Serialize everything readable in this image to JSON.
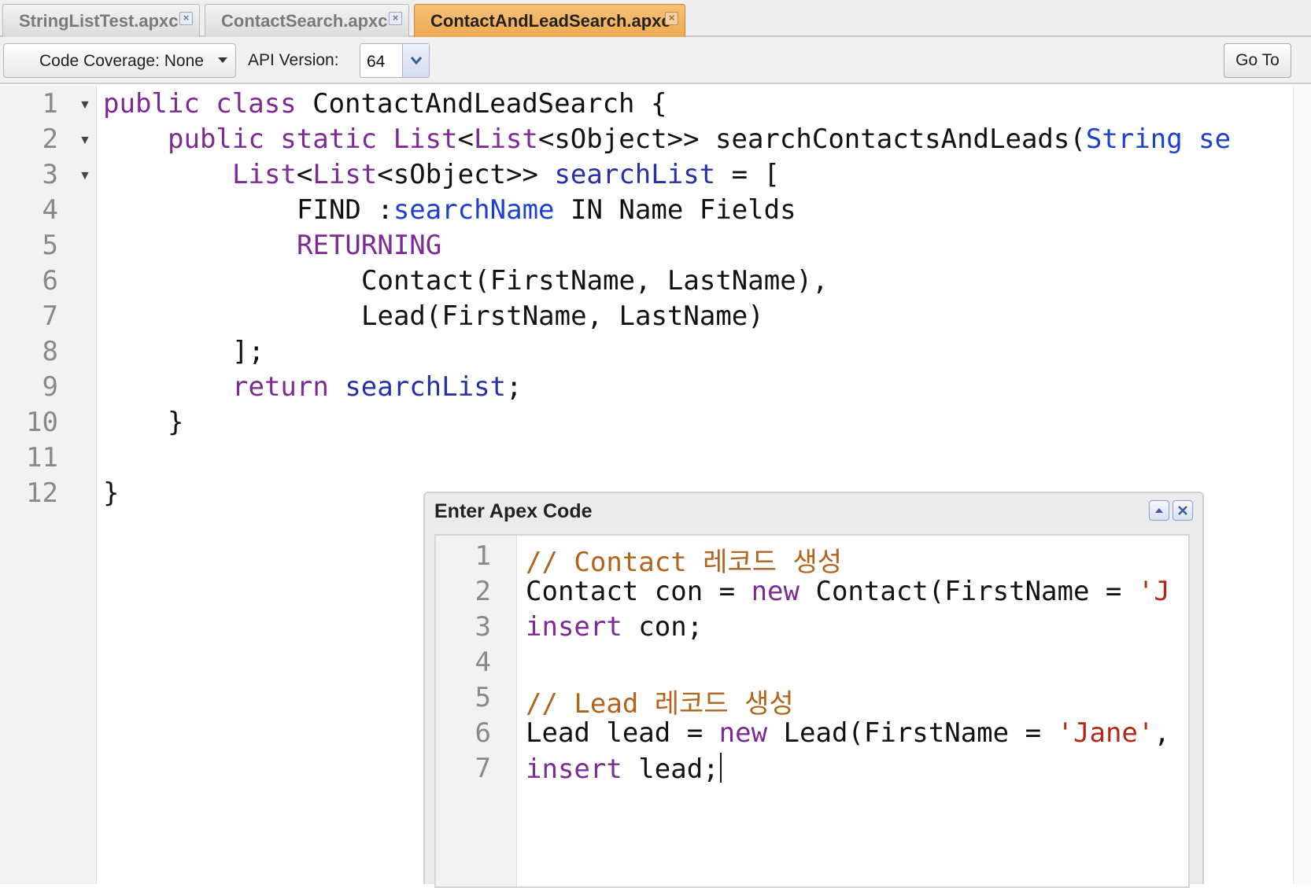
{
  "tabs": [
    {
      "label": "StringListTest.apxc",
      "active": false
    },
    {
      "label": "ContactSearch.apxc",
      "active": false
    },
    {
      "label": "ContactAndLeadSearch.apxc",
      "active": true
    }
  ],
  "toolbar": {
    "coverage_label": "Code Coverage: None",
    "api_label": "API Version:",
    "api_value": "64",
    "goto_label": "Go To"
  },
  "editor": {
    "line_numbers": [
      "1",
      "2",
      "3",
      "4",
      "5",
      "6",
      "7",
      "8",
      "9",
      "10",
      "11",
      "12"
    ],
    "lines": {
      "l1": {
        "a": "public class",
        "b": " ContactAndLeadSearch {"
      },
      "l2": {
        "a": "public static",
        "b": " ",
        "c": "List",
        "d": "<",
        "e": "List",
        "f": "<sObject>> searchContactsAndLeads(",
        "g": "String se"
      },
      "l3": {
        "a": "List",
        "b": "<",
        "c": "List",
        "d": "<sObject>> ",
        "e": "searchList",
        "f": " = ["
      },
      "l4": {
        "a": "FIND :",
        "b": "searchName",
        "c": " IN Name Fields"
      },
      "l5": {
        "a": "RETURNING"
      },
      "l6": {
        "a": "Contact(FirstName, LastName),"
      },
      "l7": {
        "a": "Lead(FirstName, LastName)"
      },
      "l8": {
        "a": "];"
      },
      "l9": {
        "a": "return",
        "b": " ",
        "c": "searchList",
        "d": ";"
      },
      "l10": {
        "a": "}"
      },
      "l12": {
        "a": "}"
      }
    }
  },
  "popup": {
    "title": "Enter Apex Code",
    "line_numbers": [
      "1",
      "2",
      "3",
      "4",
      "5",
      "6",
      "7"
    ],
    "lines": {
      "p1": {
        "a": "// Contact 레코드 생성"
      },
      "p2": {
        "a": "Contact con = ",
        "b": "new",
        "c": " Contact(FirstName = ",
        "d": "'J"
      },
      "p3": {
        "a": "insert",
        "b": " con;"
      },
      "p5": {
        "a": "// Lead 레코드 생성"
      },
      "p6": {
        "a": "Lead lead = ",
        "b": "new",
        "c": " Lead(FirstName = ",
        "d": "'Jane'",
        "e": ","
      },
      "p7": {
        "a": "insert",
        "b": " lead;"
      }
    }
  },
  "colors": {
    "keyword": "#7d2a96",
    "identifier": "#2631a8",
    "type": "#1d3fd2",
    "comment": "#b2631c",
    "string": "#b52818",
    "active_tab": "#eea94f"
  },
  "icons": {
    "tab_close": "close-icon",
    "coverage_dropdown": "caret-down-icon",
    "api_dropdown": "chevron-down-icon",
    "popup_collapse": "chevron-up-icon",
    "popup_close": "close-icon",
    "fold": "fold-triangle-icon"
  }
}
